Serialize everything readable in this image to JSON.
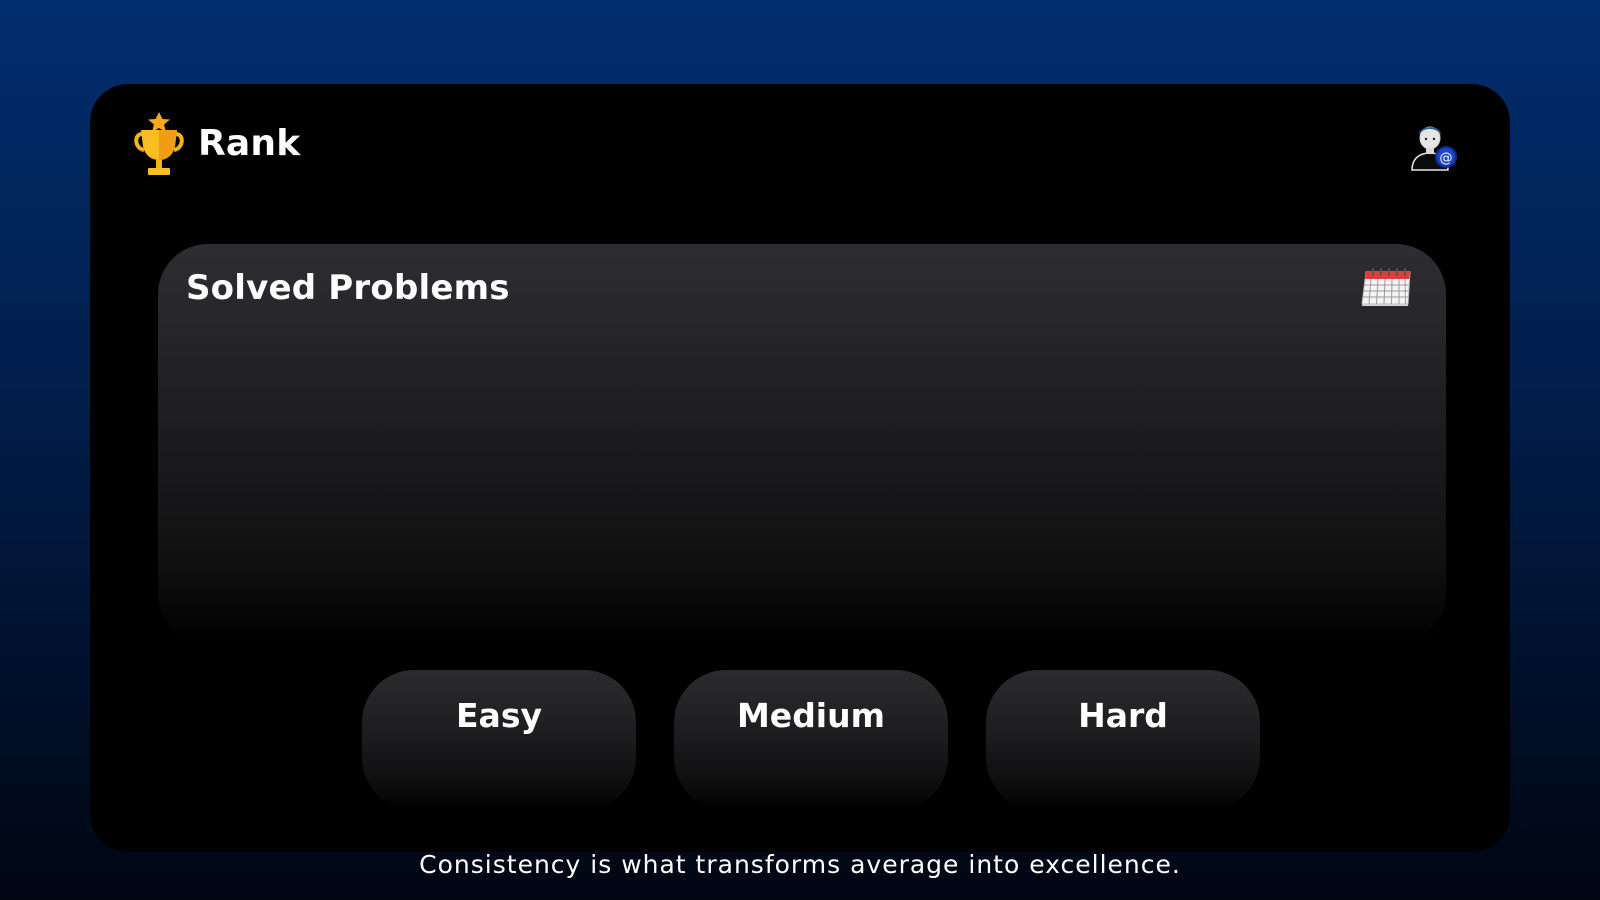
{
  "header": {
    "title": "Rank",
    "brand_icon": "trophy-icon",
    "profile_icon": "user-avatar-icon"
  },
  "solved_panel": {
    "title": "Solved Problems",
    "calendar_icon": "calendar-icon"
  },
  "difficulty": {
    "items": [
      {
        "label": "Easy"
      },
      {
        "label": "Medium"
      },
      {
        "label": "Hard"
      }
    ]
  },
  "footer": {
    "quote": "Consistency is what transforms average into excellence."
  },
  "colors": {
    "accent_gold": "#f5b21a",
    "background_top": "#012e6e",
    "card": "#000000"
  }
}
